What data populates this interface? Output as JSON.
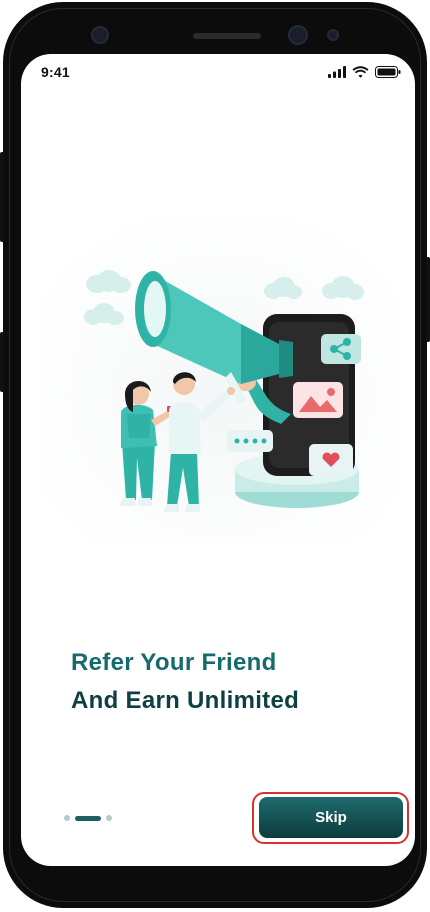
{
  "status_bar": {
    "time": "9:41",
    "icons": [
      "signal-icon",
      "wifi-icon",
      "battery-icon"
    ]
  },
  "onboarding": {
    "headline_line1": "Refer Your Friend",
    "headline_line2": "And Earn Unlimited",
    "page_count": 3,
    "active_page": 2
  },
  "actions": {
    "skip_label": "Skip"
  },
  "colors": {
    "headline_primary": "#146a6c",
    "headline_secondary": "#0f3f42",
    "accent_teal": "#3fbfb4",
    "button_gradient_start": "#1d6a6c",
    "button_gradient_end": "#0e3c3e",
    "highlight_border": "#d9322c"
  }
}
